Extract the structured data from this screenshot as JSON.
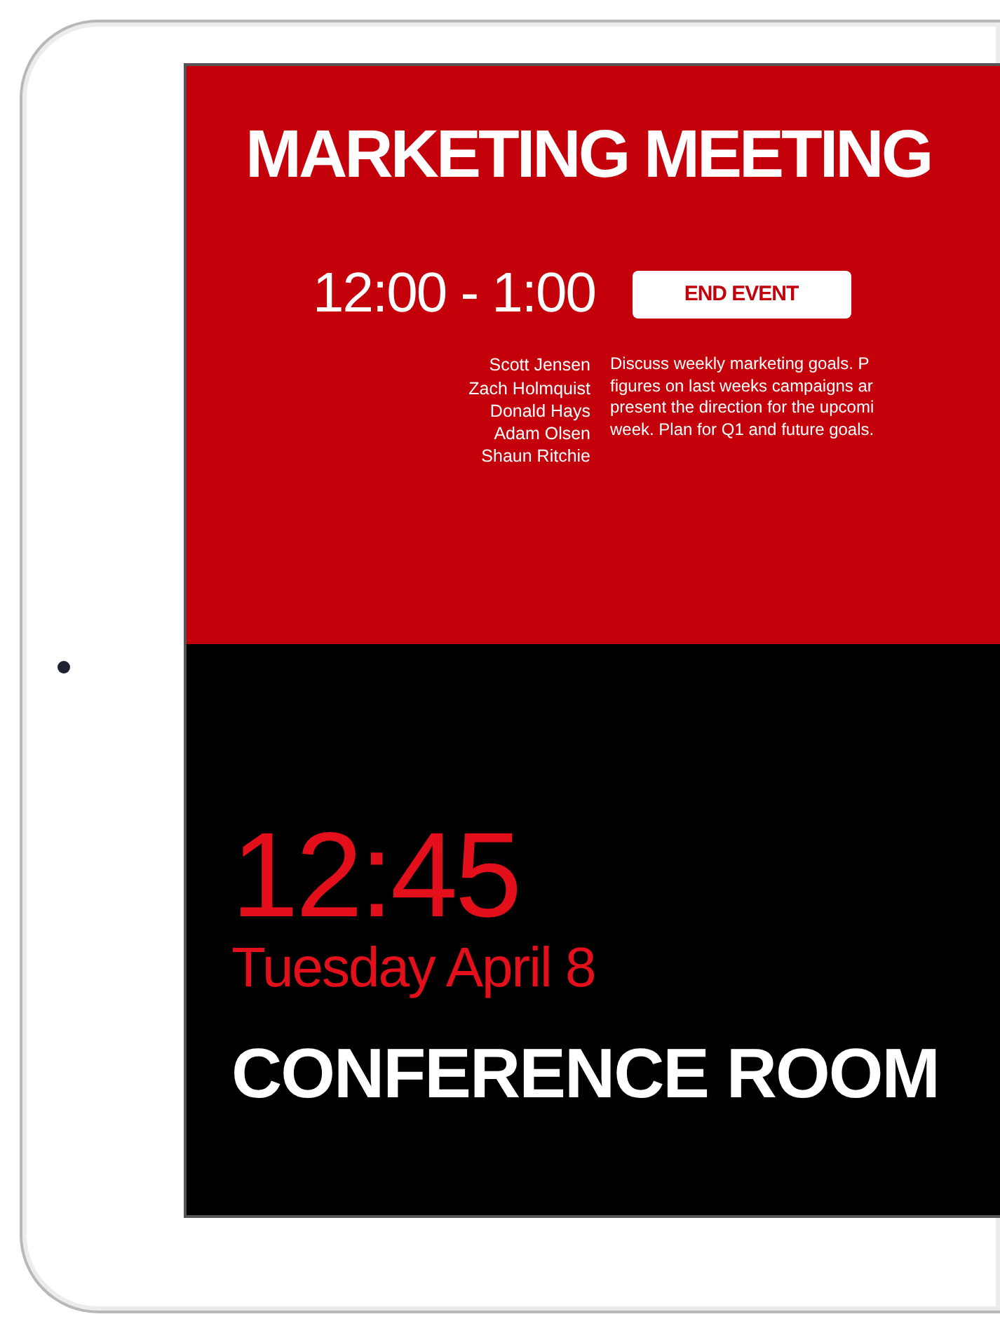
{
  "event": {
    "title": "MARKETING MEETING",
    "time": "12:00 - 1:00",
    "end_button": "END EVENT",
    "attendees": [
      "Scott Jensen",
      "Zach Holmquist",
      "Donald Hays",
      "Adam Olsen",
      "Shaun Ritchie"
    ],
    "description_lines": [
      "Discuss weekly marketing goals. P",
      "figures on last weeks campaigns ar",
      "present the direction for the upcomi",
      "week. Plan for Q1 and future goals."
    ]
  },
  "clock": {
    "time": "12:45",
    "date": "Tuesday April 8"
  },
  "room": "CONFERENCE ROOM"
}
